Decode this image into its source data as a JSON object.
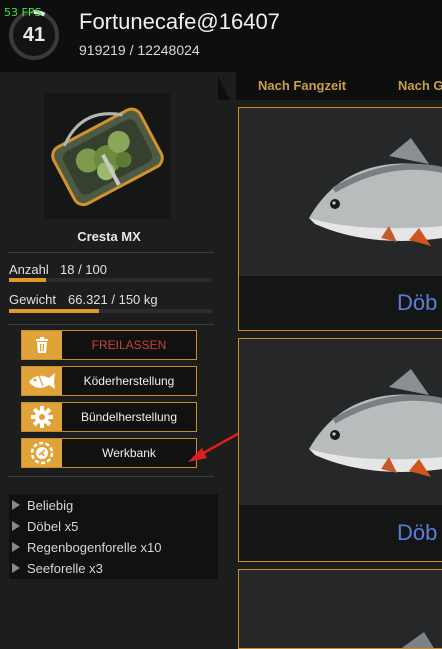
{
  "header": {
    "fps": "53 FPS",
    "level": "41",
    "level_progress": 0.075,
    "username": "Fortunecafe@16407",
    "xp": "919219 / 12248024"
  },
  "tabs": [
    "Nach Fangzeit",
    "Nach G"
  ],
  "item": {
    "name": "Cresta MX",
    "image_icon": "keepnet-icon"
  },
  "stats": {
    "count_label": "Anzahl",
    "count_value": "18 / 100",
    "count_fraction": 0.18,
    "weight_label": "Gewicht",
    "weight_value": "66.321 / 150 kg",
    "weight_fraction": 0.442
  },
  "buttons": {
    "release": "FREILASSEN",
    "bait": "Köderherstellung",
    "bundle": "Bündelherstellung",
    "workbench": "Werkbank"
  },
  "fish_list": [
    "Beliebig",
    "Döbel x5",
    "Regenbogenforelle x10",
    "Seeforelle x3"
  ],
  "cards": [
    {
      "name": "Döb"
    },
    {
      "name": "Döb"
    }
  ],
  "colors": {
    "accent": "#e0a33a",
    "release_text": "#c7413a",
    "fish_name": "#5b7ed8",
    "fps": "#39e639",
    "annotation_arrow": "#e01e1e"
  }
}
